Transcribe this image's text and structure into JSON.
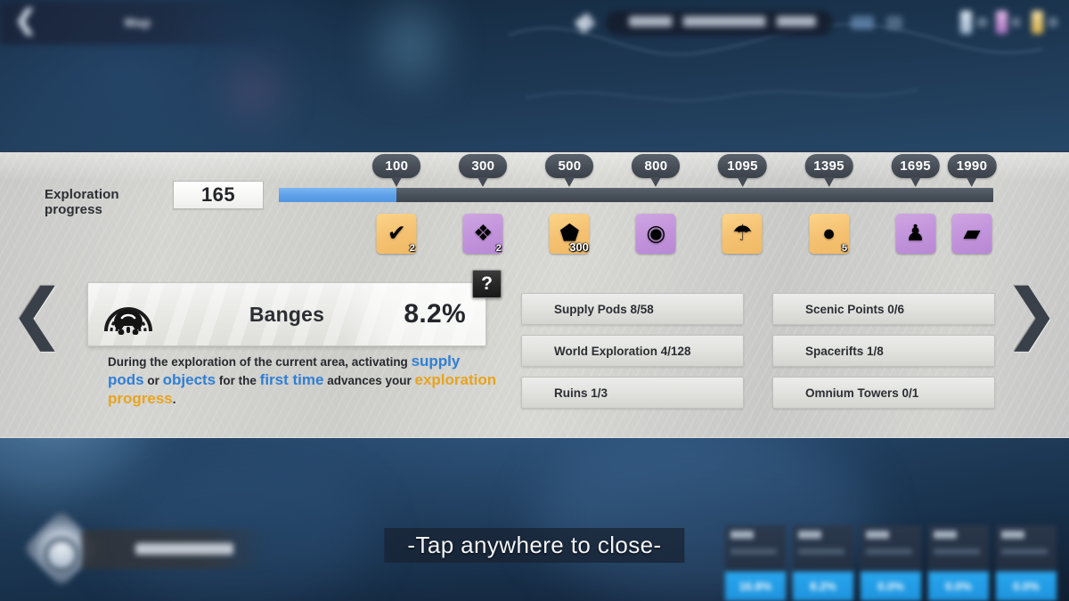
{
  "top_hud": {
    "back_icon": "chevron-left-icon",
    "map_label": "Map",
    "region_label": "Blurred Region Name",
    "pen_icon": "pen-icon"
  },
  "progress": {
    "label": "Exploration progress",
    "value": "165",
    "fill_percent": 16.5,
    "track_max": 1990,
    "milestones": [
      {
        "value": "100",
        "pos": 16.5
      },
      {
        "value": "300",
        "pos": 28.6
      },
      {
        "value": "500",
        "pos": 40.7
      },
      {
        "value": "800",
        "pos": 52.8
      },
      {
        "value": "1095",
        "pos": 64.9
      },
      {
        "value": "1395",
        "pos": 77.0
      },
      {
        "value": "1695",
        "pos": 89.1
      },
      {
        "value": "1990",
        "pos": 97.0
      }
    ],
    "rewards": [
      {
        "icon": "exploration-token-icon",
        "glyph": "✔",
        "qty": "2",
        "rarity": "gold",
        "pos": 16.5
      },
      {
        "icon": "ore-shard-icon",
        "glyph": "❖",
        "qty": "2",
        "rarity": "purple",
        "pos": 28.6
      },
      {
        "icon": "currency-crate-icon",
        "glyph": "⬟",
        "qty": "300",
        "rarity": "gold",
        "pos": 40.7
      },
      {
        "icon": "relic-core-icon",
        "glyph": "◉",
        "qty": "",
        "rarity": "purple",
        "pos": 52.8
      },
      {
        "icon": "mushroom-icon",
        "glyph": "☂",
        "qty": "",
        "rarity": "gold",
        "pos": 64.9
      },
      {
        "icon": "gold-orb-icon",
        "glyph": "●",
        "qty": "5",
        "rarity": "gold",
        "pos": 77.0
      },
      {
        "icon": "robot-outfit-icon",
        "glyph": "♟",
        "qty": "",
        "rarity": "purple",
        "pos": 89.1
      },
      {
        "icon": "blueprint-icon",
        "glyph": "▰",
        "qty": "",
        "rarity": "purple",
        "pos": 97.0
      }
    ]
  },
  "area": {
    "logo_icon": "banges-emblem-icon",
    "name": "Banges",
    "percent": "8.2%",
    "help_label": "?"
  },
  "description": {
    "part1": "During the exploration of the current area, activating ",
    "hl1": "supply pods",
    "part2": " or ",
    "hl2": "objects",
    "part3": " for the ",
    "hl3": "first time",
    "part4": " advances your ",
    "hl4": "exploration progress",
    "part5": "."
  },
  "stats": {
    "left_column": [
      "Supply Pods 8/58",
      "World Exploration 4/128",
      "Ruins 1/3"
    ],
    "right_column": [
      "Scenic Points 0/6",
      "Spacerifts 1/8",
      "Omnium Towers 0/1"
    ]
  },
  "nav": {
    "prev_icon": "chevron-left-icon",
    "next_icon": "chevron-right-icon",
    "prev_label": "❮",
    "next_label": "❯"
  },
  "bottom_hud": {
    "tap_to_close": "-Tap anywhere to close-",
    "region_name": "Auspicia",
    "mini_cards": [
      {
        "percent": "16.8%"
      },
      {
        "percent": "8.2%"
      },
      {
        "percent": "0.0%"
      },
      {
        "percent": "0.0%"
      },
      {
        "percent": "0.0%"
      }
    ]
  },
  "colors": {
    "panel_bg": "#d2d2cf",
    "track_empty": "#464d56",
    "track_fill": "#5d9fe8",
    "accent_blue": "#2f7fd6",
    "accent_gold": "#e8a41f",
    "bubble": "#474e57"
  }
}
